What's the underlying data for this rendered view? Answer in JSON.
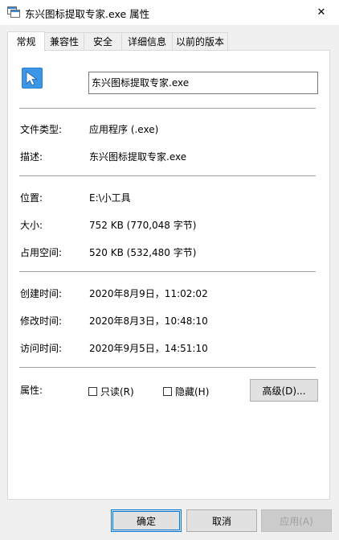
{
  "window": {
    "title": "东兴图标提取专家.exe 属性",
    "close_glyph": "✕"
  },
  "tabs": [
    {
      "label": "常规",
      "active": true
    },
    {
      "label": "兼容性"
    },
    {
      "label": "安全"
    },
    {
      "label": "详细信息"
    },
    {
      "label": "以前的版本"
    }
  ],
  "general": {
    "file_name": "东兴图标提取专家.exe",
    "file_type_label": "文件类型:",
    "file_type_value": "应用程序 (.exe)",
    "description_label": "描述:",
    "description_value": "东兴图标提取专家.exe",
    "location_label": "位置:",
    "location_value": "E:\\小工具",
    "size_label": "大小:",
    "size_value": "752 KB (770,048 字节)",
    "size_on_disk_label": "占用空间:",
    "size_on_disk_value": "520 KB (532,480 字节)",
    "created_label": "创建时间:",
    "created_value": "2020年8月9日，11:02:02",
    "modified_label": "修改时间:",
    "modified_value": "2020年8月3日，10:48:10",
    "accessed_label": "访问时间:",
    "accessed_value": "2020年9月5日，14:51:10",
    "attributes_label": "属性:",
    "readonly_label": "只读(R)",
    "hidden_label": "隐藏(H)",
    "advanced_label": "高级(D)..."
  },
  "footer": {
    "ok_label": "确定",
    "cancel_label": "取消",
    "apply_label": "应用(A)"
  },
  "colors": {
    "accent": "#0078d7",
    "icon_blue": "#2b7fd4"
  }
}
